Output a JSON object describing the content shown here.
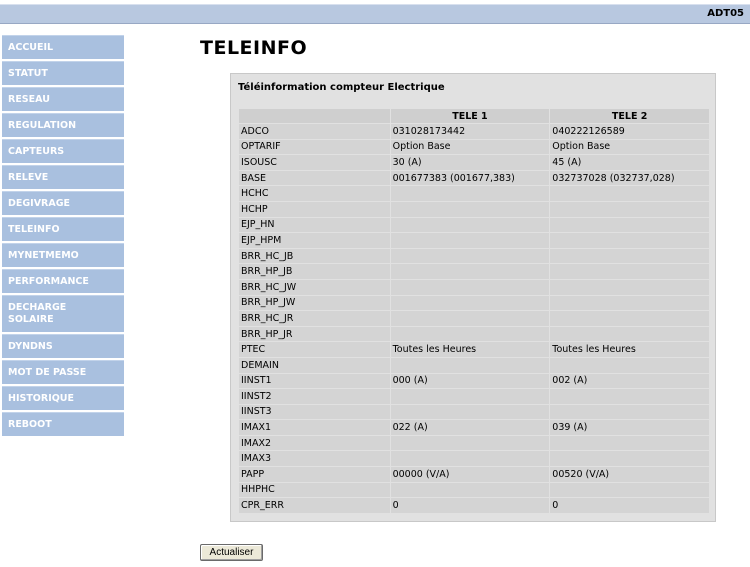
{
  "header": {
    "device_name": "ADT05"
  },
  "sidebar": {
    "items": [
      {
        "label": "ACCUEIL"
      },
      {
        "label": "STATUT"
      },
      {
        "label": "RESEAU"
      },
      {
        "label": "REGULATION"
      },
      {
        "label": "CAPTEURS"
      },
      {
        "label": "RELEVE"
      },
      {
        "label": "DEGIVRAGE"
      },
      {
        "label": "TELEINFO"
      },
      {
        "label": "MYNETMEMO"
      },
      {
        "label": "PERFORMANCE"
      },
      {
        "label": "DECHARGE\nSOLAIRE"
      },
      {
        "label": "DYNDNS"
      },
      {
        "label": "MOT DE PASSE"
      },
      {
        "label": "HISTORIQUE"
      },
      {
        "label": "REBOOT"
      }
    ]
  },
  "page": {
    "title": "TELEINFO"
  },
  "panel": {
    "title": "Téléinformation compteur Electrique",
    "columns": [
      "",
      "TELE 1",
      "TELE 2"
    ],
    "rows": [
      [
        "ADCO",
        "031028173442",
        "040222126589"
      ],
      [
        "OPTARIF",
        "Option Base",
        "Option Base"
      ],
      [
        "ISOUSC",
        "30 (A)",
        "45 (A)"
      ],
      [
        "BASE",
        "001677383 (001677,383)",
        "032737028 (032737,028)"
      ],
      [
        "HCHC",
        "",
        ""
      ],
      [
        "HCHP",
        "",
        ""
      ],
      [
        "EJP_HN",
        "",
        ""
      ],
      [
        "EJP_HPM",
        "",
        ""
      ],
      [
        "BRR_HC_JB",
        "",
        ""
      ],
      [
        "BRR_HP_JB",
        "",
        ""
      ],
      [
        "BRR_HC_JW",
        "",
        ""
      ],
      [
        "BRR_HP_JW",
        "",
        ""
      ],
      [
        "BRR_HC_JR",
        "",
        ""
      ],
      [
        "BRR_HP_JR",
        "",
        ""
      ],
      [
        "PTEC",
        "Toutes les Heures",
        "Toutes les Heures"
      ],
      [
        "DEMAIN",
        "",
        ""
      ],
      [
        "IINST1",
        "000 (A)",
        "002 (A)"
      ],
      [
        "IINST2",
        "",
        ""
      ],
      [
        "IINST3",
        "",
        ""
      ],
      [
        "IMAX1",
        "022 (A)",
        "039 (A)"
      ],
      [
        "IMAX2",
        "",
        ""
      ],
      [
        "IMAX3",
        "",
        ""
      ],
      [
        "PAPP",
        "00000 (V/A)",
        "00520 (V/A)"
      ],
      [
        "HHPHC",
        "",
        ""
      ],
      [
        "CPR_ERR",
        "0",
        "0"
      ]
    ]
  },
  "actions": {
    "refresh_label": "Actualiser"
  },
  "colors": {
    "nav_bg": "#a9c0df",
    "topbar_bg": "#b8c8e0",
    "panel_bg": "#e1e1e1",
    "cell_bg": "#d4d4d4"
  }
}
